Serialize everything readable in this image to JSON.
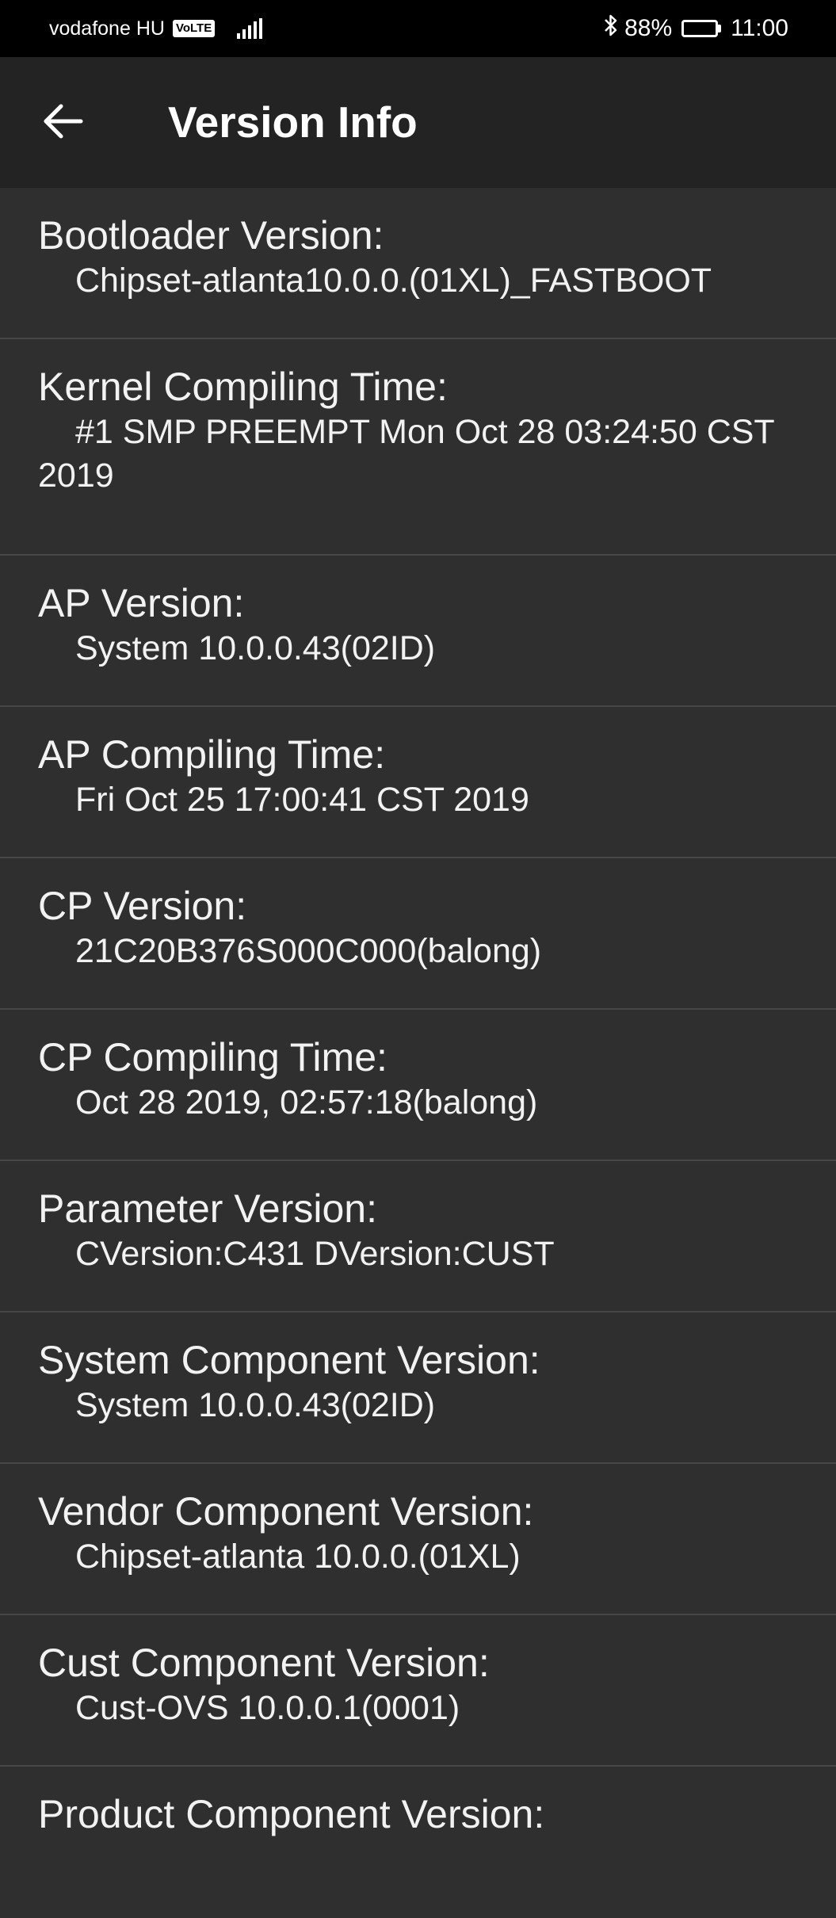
{
  "status_bar": {
    "carrier": "vodafone HU",
    "volte": "VoLTE",
    "battery_percent": "88%",
    "battery_level": 0.88,
    "time": "11:00",
    "icons": [
      "volte-badge-icon",
      "signal-icon",
      "bluetooth-icon",
      "battery-icon"
    ]
  },
  "app_bar": {
    "title": "Version Info",
    "back_icon": "arrow-left-icon"
  },
  "items": [
    {
      "label": "Bootloader Version:",
      "value": "Chipset-atlanta10.0.0.(01XL)_FASTBOOT"
    },
    {
      "label": "Kernel Compiling Time:",
      "value": "#1 SMP PREEMPT Mon Oct 28 03:24:50 CST 2019"
    },
    {
      "label": "AP Version:",
      "value": "System 10.0.0.43(02ID)"
    },
    {
      "label": "AP Compiling Time:",
      "value": "Fri Oct 25 17:00:41 CST 2019"
    },
    {
      "label": "CP Version:",
      "value": "21C20B376S000C000(balong)"
    },
    {
      "label": "CP Compiling Time:",
      "value": "Oct 28 2019, 02:57:18(balong)"
    },
    {
      "label": "Parameter Version:",
      "value": "CVersion:C431 DVersion:CUST"
    },
    {
      "label": "System Component Version:",
      "value": "System 10.0.0.43(02ID)"
    },
    {
      "label": "Vendor Component Version:",
      "value": "Chipset-atlanta 10.0.0.(01XL)"
    },
    {
      "label": "Cust Component Version:",
      "value": "Cust-OVS 10.0.0.1(0001)"
    },
    {
      "label": "Product Component Version:",
      "value": ""
    }
  ]
}
